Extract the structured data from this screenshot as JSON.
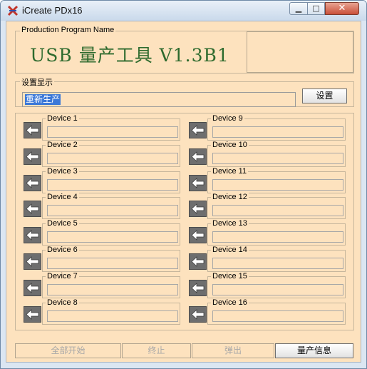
{
  "window": {
    "title": "iCreate PDx16"
  },
  "program": {
    "group_label": "Production Program Name",
    "name": "USB 量产工具 V1.3B1"
  },
  "settings": {
    "group_label": "设置显示",
    "value": "重新生产",
    "button_label": "设置"
  },
  "devices": [
    "Device 1",
    "Device 2",
    "Device 3",
    "Device 4",
    "Device 5",
    "Device 6",
    "Device 7",
    "Device 8",
    "Device 9",
    "Device 10",
    "Device 11",
    "Device 12",
    "Device 13",
    "Device 14",
    "Device 15",
    "Device 16"
  ],
  "actions": {
    "start_all": "全部开始",
    "stop": "终止",
    "eject": "弹出",
    "info": "量产信息"
  },
  "colors": {
    "background": "#fde2be",
    "title_text": "#2d6a2d",
    "arrow_button": "#6e6e6e"
  }
}
